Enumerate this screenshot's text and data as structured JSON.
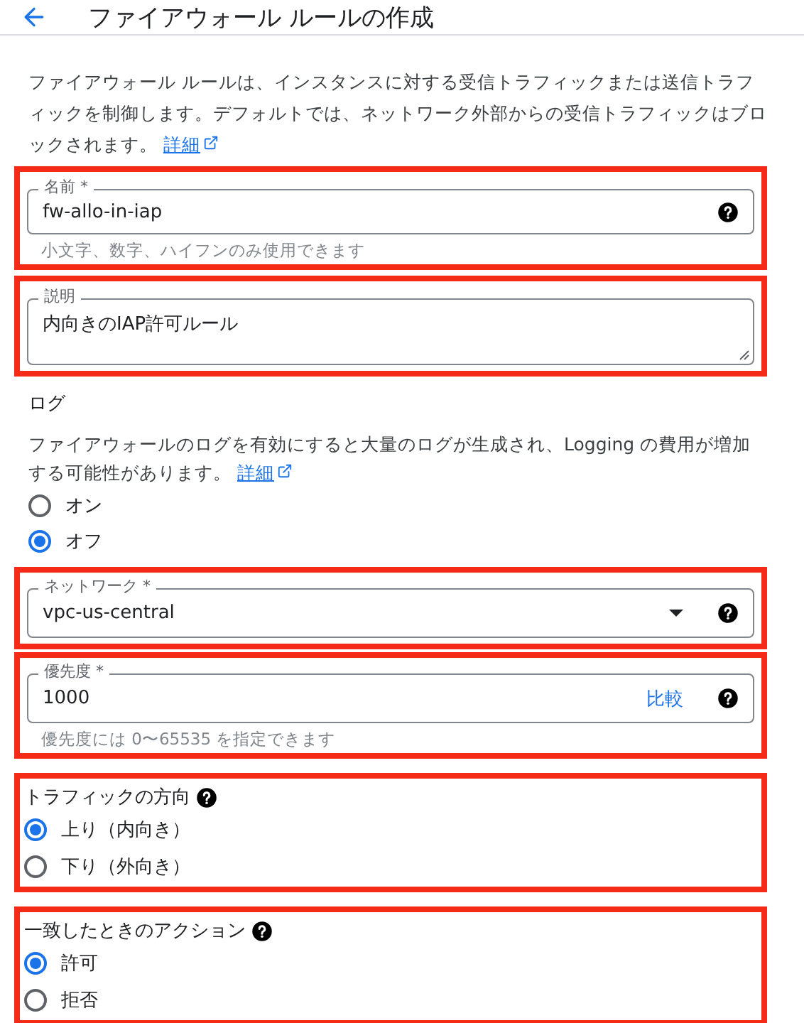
{
  "header": {
    "title": "ファイアウォール ルールの作成"
  },
  "intro": {
    "text": "ファイアウォール ルールは、インスタンスに対する受信トラフィックまたは送信トラフィックを制御します。デフォルトでは、ネットワーク外部からの受信トラフィックはブロックされます。",
    "link": "詳細"
  },
  "name_field": {
    "label": "名前 *",
    "value": "fw-allo-in-iap",
    "hint": "小文字、数字、ハイフンのみ使用できます",
    "highlighted": true
  },
  "description_field": {
    "label": "説明",
    "value": "内向きのIAP許可ルール",
    "highlighted": true
  },
  "logs": {
    "heading": "ログ",
    "text": "ファイアウォールのログを有効にすると大量のログが生成され、Logging の費用が増加する可能性があります。",
    "link": "詳細",
    "options": [
      {
        "label": "オン",
        "selected": false
      },
      {
        "label": "オフ",
        "selected": true
      }
    ]
  },
  "network_field": {
    "label": "ネットワーク *",
    "value": "vpc-us-central",
    "highlighted": true
  },
  "priority_field": {
    "label": "優先度 *",
    "value": "1000",
    "action": "比較",
    "hint": "優先度には 0〜65535 を指定できます",
    "highlighted": true
  },
  "traffic_direction": {
    "heading": "トラフィックの方向",
    "highlighted": true,
    "options": [
      {
        "label": "上り（内向き）",
        "selected": true
      },
      {
        "label": "下り（外向き）",
        "selected": false
      }
    ]
  },
  "match_action": {
    "heading": "一致したときのアクション",
    "highlighted": true,
    "options": [
      {
        "label": "許可",
        "selected": true
      },
      {
        "label": "拒否",
        "selected": false
      }
    ]
  }
}
